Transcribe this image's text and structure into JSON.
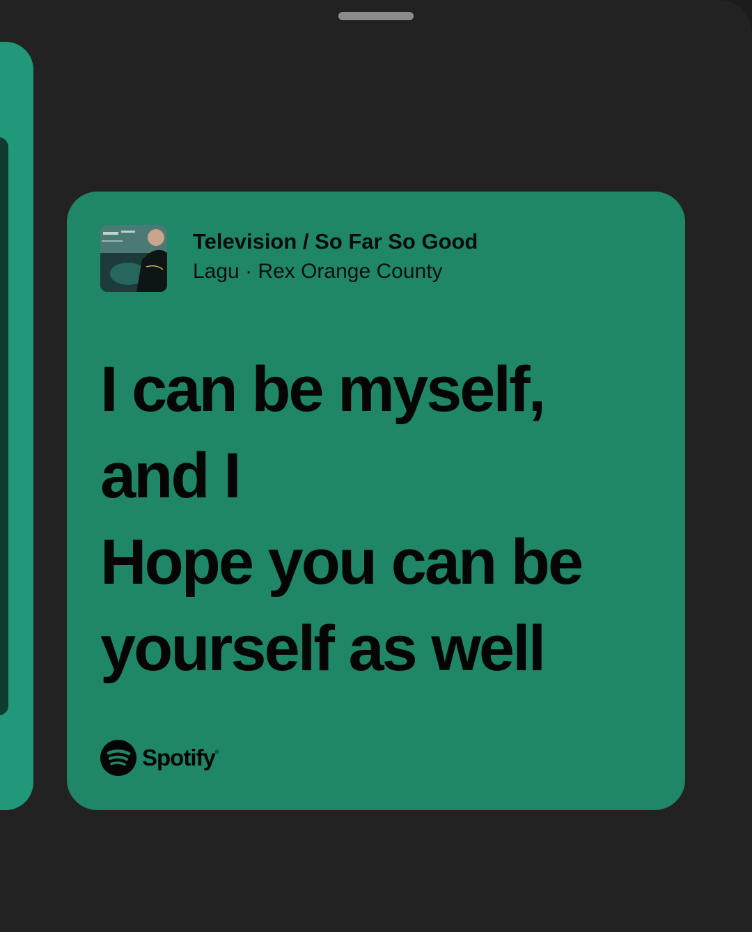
{
  "card": {
    "track_title": "Television / So Far So Good",
    "track_subtitle": "Lagu · Rex Orange County",
    "lyrics": [
      "I can be myself,",
      "and I",
      "Hope you can be",
      "yourself as well"
    ],
    "brand": "Spotify",
    "cover_icon": "album-cover-art",
    "brand_icon": "spotify-logo-icon"
  },
  "colors": {
    "background": "#222222",
    "card": "#1f8768",
    "peek_card": "#21987a",
    "text": "#050505"
  }
}
